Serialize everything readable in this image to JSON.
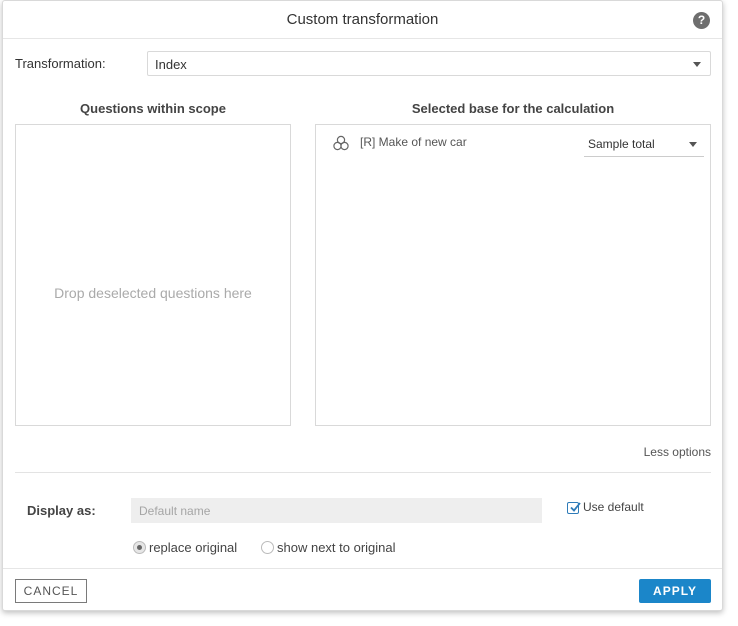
{
  "dialog": {
    "title": "Custom transformation",
    "help_icon_glyph": "?"
  },
  "transformation": {
    "label": "Transformation:",
    "selected": "Index"
  },
  "scope": {
    "heading": "Questions within scope",
    "drop_hint": "Drop deselected questions here"
  },
  "base": {
    "heading": "Selected base for the calculation",
    "rows": [
      {
        "icon": "multi-response-icon",
        "label": "[R] Make of new car",
        "base_value": "Sample total"
      }
    ]
  },
  "less_options": "Less options",
  "display": {
    "label": "Display as:",
    "name_placeholder": "Default name",
    "use_default_label": "Use default",
    "use_default_checked": true,
    "radio_options": [
      "replace original",
      "show next to original"
    ],
    "radio_selected": "replace original"
  },
  "footer": {
    "cancel_label": "CANCEL",
    "apply_label": "APPLY"
  },
  "colors": {
    "accent": "#1b86c9",
    "border": "#d9d9d9",
    "input_bg": "#eeeeee"
  }
}
